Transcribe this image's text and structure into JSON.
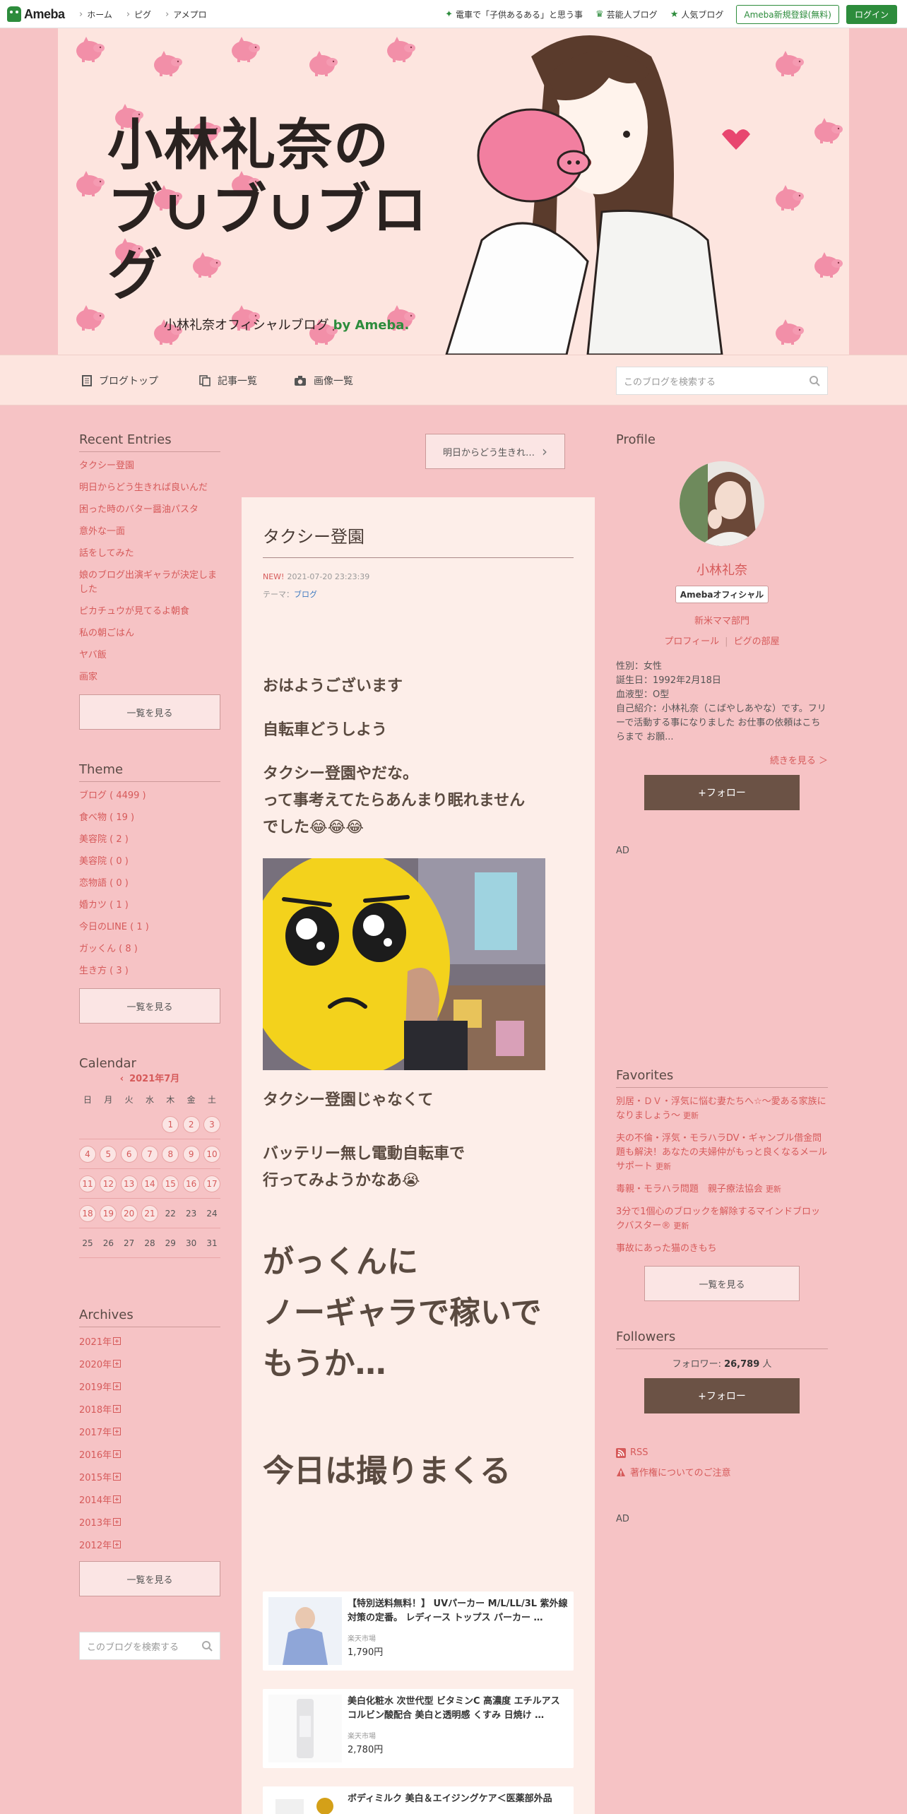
{
  "topbar": {
    "logo": "Ameba",
    "crumbs": [
      "ホーム",
      "ピグ",
      "アメプロ"
    ],
    "links": [
      "電車で「子供あるある」と思う事",
      "芸能人ブログ",
      "人気ブログ"
    ],
    "register": "Ameba新規登録(無料)",
    "login": "ログイン"
  },
  "banner": {
    "title_line1": "小林礼奈の",
    "title_line2": "ブ∪ブ∪ブログ",
    "subtitle": "小林礼奈オフィシャルブログ",
    "by": "by Ameba."
  },
  "blognav": {
    "top": "ブログトップ",
    "list": "記事一覧",
    "images": "画像一覧",
    "search_placeholder": "このブログを検索する"
  },
  "left": {
    "recent_title": "Recent Entries",
    "recent": [
      "タクシー登園",
      "明日からどう生きれば良いんだ",
      "困った時のバター醤油パスタ",
      "意外な一面",
      "話をしてみた",
      "娘のブログ出演ギャラが決定しました",
      "ピカチュウが見てるよ朝食",
      "私の朝ごはん",
      "ヤバ飯",
      "画家"
    ],
    "more": "一覧を見る",
    "theme_title": "Theme",
    "themes": [
      "ブログ ( 4499 )",
      "食べ物 ( 19 )",
      "美容院 ( 2 )",
      "美容院 ( 0 )",
      "恋物語 ( 0 )",
      "婚カツ ( 1 )",
      "今日のLINE ( 1 )",
      "ガッくん ( 8 )",
      "生き方 ( 3 )"
    ],
    "calendar_title": "Calendar",
    "calendar_month": "2021年7月",
    "dow": [
      "日",
      "月",
      "火",
      "水",
      "木",
      "金",
      "土"
    ],
    "weeks": [
      [
        "",
        "",
        "",
        "",
        "1",
        "2",
        "3"
      ],
      [
        "4",
        "5",
        "6",
        "7",
        "8",
        "9",
        "10"
      ],
      [
        "11",
        "12",
        "13",
        "14",
        "15",
        "16",
        "17"
      ],
      [
        "18",
        "19",
        "20",
        "21",
        "22",
        "23",
        "24"
      ],
      [
        "25",
        "26",
        "27",
        "28",
        "29",
        "30",
        "31"
      ]
    ],
    "posted_days": [
      "1",
      "2",
      "3",
      "4",
      "5",
      "6",
      "7",
      "8",
      "9",
      "10",
      "11",
      "12",
      "13",
      "14",
      "15",
      "16",
      "17",
      "18",
      "19",
      "20",
      "21"
    ],
    "archives_title": "Archives",
    "archives": [
      "2021年",
      "2020年",
      "2019年",
      "2018年",
      "2017年",
      "2016年",
      "2015年",
      "2014年",
      "2013年",
      "2012年"
    ],
    "search_placeholder": "このブログを検索する"
  },
  "main": {
    "prev_entry": "明日からどう生きれ…",
    "title": "タクシー登園",
    "new_badge": "NEW!",
    "datetime": "2021-07-20 23:23:39",
    "theme_label": "テーマ：",
    "theme": "ブログ",
    "p1": "おはようございます",
    "p2": "自転車どうしよう",
    "p3a": "タクシー登園やだな。",
    "p3b": "って事考えてたらあんまり眠れません",
    "p3c": "でした😂😂😂",
    "p4": "タクシー登園じゃなくて",
    "p5a": "バッテリー無し電動自転車で",
    "p5b": "行ってみようかなあ😭",
    "big1a": "がっくんに",
    "big1b": "ノーギャラで稼いで",
    "big1c": "もうか…",
    "big2": "今日は撮りまくる",
    "products": [
      {
        "name": "【特別送料無料！】 UVパーカー M/L/LL/3L 紫外線対策の定番。 レディース トップス パーカー …",
        "shop": "楽天市場",
        "price": "1,790円"
      },
      {
        "name": "美白化粧水 次世代型 ビタミンC 高濃度 エチルアスコルビン酸配合 美白と透明感 くすみ 日焼け …",
        "shop": "楽天市場",
        "price": "2,780円"
      },
      {
        "name": "ボディミルク 美白＆エイジングケア＜医薬部外品",
        "shop": "",
        "price": ""
      }
    ]
  },
  "right": {
    "profile_title": "Profile",
    "name": "小林礼奈",
    "badge": "Amebaオフィシャル",
    "genre": "新米ママ部門",
    "link_profile": "プロフィール",
    "link_pig": "ピグの部屋",
    "info": [
      "性別：女性",
      "誕生日：1992年2月18日",
      "血液型：O型",
      "自己紹介：小林礼奈（こばやしあやな）です。フリーで活動する事になりました お仕事の依頼はこちらまで お願..."
    ],
    "more": "続きを見る ＞",
    "follow": "+フォロー",
    "ad": "AD",
    "favorites_title": "Favorites",
    "favorites": [
      {
        "text": "別居・ＤＶ・浮気に悩む妻たちへ☆～愛ある家族になりましょう～",
        "upd": "更新"
      },
      {
        "text": "夫の不倫・浮気・モラハラDV・ギャンブル借金問題も解決！あなたの夫婦仲がもっと良くなるメールサポート",
        "upd": "更新"
      },
      {
        "text": "毒親・モラハラ問題　親子療法協会",
        "upd": "更新"
      },
      {
        "text": "3分で1個心のブロックを解除するマインドブロックバスター®",
        "upd": "更新"
      },
      {
        "text": "事故にあった猫のきもち",
        "upd": ""
      }
    ],
    "fav_more": "一覧を見る",
    "followers_title": "Followers",
    "followers_label": "フォロワー: ",
    "followers_count": "26,789",
    "followers_unit": " 人",
    "rss": "RSS",
    "copyright": "著作権についてのご注意"
  },
  "colors": {
    "accent": "#d65a5a",
    "ameba_green": "#2d8c3c",
    "page_bg": "#f6c3c5",
    "follow_btn": "#6b5245"
  }
}
